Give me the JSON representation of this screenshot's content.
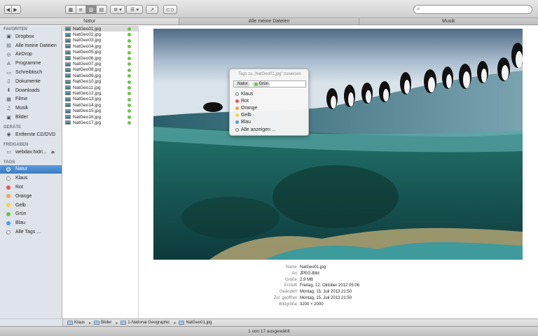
{
  "toolbar": {
    "back": "◀",
    "forward": "▶",
    "view_modes": [
      "▦",
      "≡",
      "▥",
      "▤"
    ],
    "action": "✲ ▾",
    "arrange": "☰ ▾",
    "share": "↗",
    "tags": "⊂⊃",
    "search_placeholder": ""
  },
  "tabs": [
    {
      "label": "Natur",
      "selected": true
    },
    {
      "label": "Alle meine Dateien",
      "selected": false
    },
    {
      "label": "Musik",
      "selected": false
    }
  ],
  "sidebar": {
    "favorites_header": "FAVORITEN",
    "favorites": [
      {
        "label": "Dropbox",
        "icon": "dropbox-icon",
        "glyph": "▣"
      },
      {
        "label": "Alle meine Dateien",
        "icon": "all-files-icon",
        "glyph": "▤"
      },
      {
        "label": "AirDrop",
        "icon": "airdrop-icon",
        "glyph": "◎"
      },
      {
        "label": "Programme",
        "icon": "applications-icon",
        "glyph": "A"
      },
      {
        "label": "Schreibtisch",
        "icon": "desktop-icon",
        "glyph": "▭"
      },
      {
        "label": "Dokumente",
        "icon": "documents-icon",
        "glyph": "▯"
      },
      {
        "label": "Downloads",
        "icon": "downloads-icon",
        "glyph": "⬇"
      },
      {
        "label": "Filme",
        "icon": "movies-icon",
        "glyph": "▦"
      },
      {
        "label": "Musik",
        "icon": "music-icon",
        "glyph": "♫"
      },
      {
        "label": "Bilder",
        "icon": "pictures-icon",
        "glyph": "▣"
      }
    ],
    "devices_header": "GERÄTE",
    "devices": [
      {
        "label": "Entfernte CD/DVD",
        "icon": "disc-icon",
        "glyph": "◉"
      }
    ],
    "shared_header": "FREIGABEN",
    "shared": [
      {
        "label": "webdav.hidri...",
        "icon": "server-icon",
        "glyph": "▭",
        "eject": "⏏"
      }
    ],
    "tags_header": "TAGS",
    "tags": [
      {
        "label": "Natur",
        "color": "#6fa8e0",
        "selected": true
      },
      {
        "label": "Klaus",
        "color": "",
        "selected": false
      },
      {
        "label": "Rot",
        "color": "#f0534f",
        "selected": false
      },
      {
        "label": "Orange",
        "color": "#f5a33a",
        "selected": false
      },
      {
        "label": "Gelb",
        "color": "#f4d43c",
        "selected": false
      },
      {
        "label": "Grün",
        "color": "#6cc644",
        "selected": false
      },
      {
        "label": "Blau",
        "color": "#4f9be8",
        "selected": false
      },
      {
        "label": "Alle Tags ...",
        "color": "",
        "selected": false
      }
    ]
  },
  "files": [
    "NatGeo01.jpg",
    "NatGeo02.jpg",
    "NatGeo03.jpg",
    "NatGeo04.jpg",
    "NatGeo05.jpg",
    "NatGeo06.jpg",
    "NatGeo07.jpg",
    "NatGeo08.jpg",
    "NatGeo09.jpg",
    "NatGeo10.jpg",
    "NatGeo11.jpg",
    "NatGeo12.jpg",
    "NatGeo13.jpg",
    "NatGeo14.jpg",
    "NatGeo15.jpg",
    "NatGeo16.jpg",
    "NatGeo17.jpg"
  ],
  "file_tag_color": "#6cc644",
  "popover": {
    "title": "Tags zu „NatGeo01.jpg“ zuweisen",
    "tokens": [
      {
        "label": "Natur",
        "color": ""
      },
      {
        "label": "Grün",
        "color": "#6cc644"
      }
    ],
    "items": [
      {
        "label": "Klaus",
        "color": ""
      },
      {
        "label": "Rot",
        "color": "#f0534f"
      },
      {
        "label": "Orange",
        "color": "#f5a33a"
      },
      {
        "label": "Gelb",
        "color": "#f4d43c"
      },
      {
        "label": "Blau",
        "color": "#4f9be8"
      },
      {
        "label": "Alle anzeigen ...",
        "color": ""
      }
    ]
  },
  "info": [
    {
      "key": "Name",
      "value": "NatGeo01.jpg"
    },
    {
      "key": "Art",
      "value": "JPEG-Bild"
    },
    {
      "key": "Größe",
      "value": "2,9 MB"
    },
    {
      "key": "Erstellt",
      "value": "Freitag, 12. Oktober 2012 05:06"
    },
    {
      "key": "Geändert",
      "value": "Montag, 15. Juli 2013 21:50"
    },
    {
      "key": "Zul. geöffnet",
      "value": "Montag, 15. Juli 2013 21:50"
    },
    {
      "key": "Bildgröße",
      "value": "3200 × 2000"
    }
  ],
  "path": [
    "Klaus",
    "Bilder",
    "1-National Geographic",
    "NatGeo01.jpg"
  ],
  "status": "1 von 17 ausgewählt"
}
